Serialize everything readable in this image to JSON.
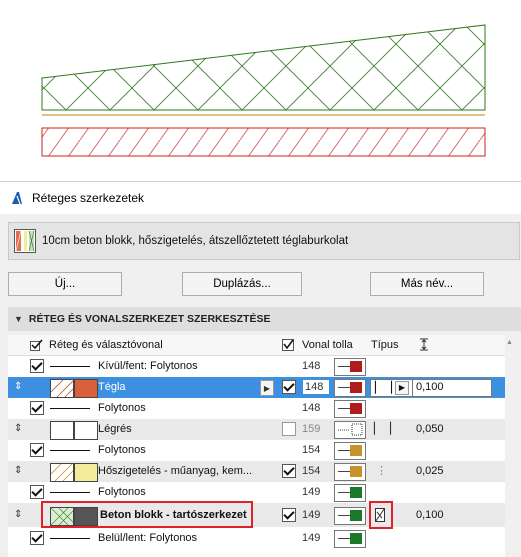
{
  "dialog": {
    "title": "Réteges szerkezetek",
    "composite_name": "10cm beton blokk, hőszigetelés, átszellőztetett téglaburkolat",
    "buttons": {
      "new": "Új...",
      "duplicate": "Duplázás...",
      "rename": "Más név..."
    },
    "section_title": "RÉTEG ÉS VONALSZERKEZET SZERKESZTÉSE"
  },
  "table": {
    "headers": {
      "layer": "Réteg és választóvonal",
      "pen": "Vonal tolla",
      "type": "Típus"
    },
    "rows": [
      {
        "kind": "line",
        "label": "Kívül/fent: Folytonos",
        "pen": "148",
        "color": "#b01c1c"
      },
      {
        "kind": "layer",
        "label": "Tégla",
        "pen": "148",
        "color": "#b01c1c",
        "fill_color": "#d9603a",
        "thickness": "0,100",
        "selected": true
      },
      {
        "kind": "line",
        "label": "Folytonos",
        "pen": "148",
        "color": "#b01c1c"
      },
      {
        "kind": "layer",
        "label": "Légrés",
        "pen": "159",
        "color": "#333333",
        "fill_color": "#ffffff",
        "thickness": "0,050"
      },
      {
        "kind": "line",
        "label": "Folytonos",
        "pen": "154",
        "color": "#c8922a"
      },
      {
        "kind": "layer",
        "label": "Hőszigetelés - műanyag, kem...",
        "pen": "154",
        "color": "#c8922a",
        "fill_color": "#f2ec9a",
        "thickness": "0,025"
      },
      {
        "kind": "line",
        "label": "Folytonos",
        "pen": "149",
        "color": "#1a7a2a"
      },
      {
        "kind": "layer",
        "label": "Beton blokk - tartószerkezet",
        "pen": "149",
        "color": "#1a7a2a",
        "fill_color": "#555555",
        "thickness": "0,100"
      },
      {
        "kind": "line",
        "label": "Belül/lent: Folytonos",
        "pen": "149",
        "color": "#1a7a2a"
      }
    ]
  },
  "colors": {
    "selection": "#3d8fe0",
    "highlight": "#e0202a"
  }
}
